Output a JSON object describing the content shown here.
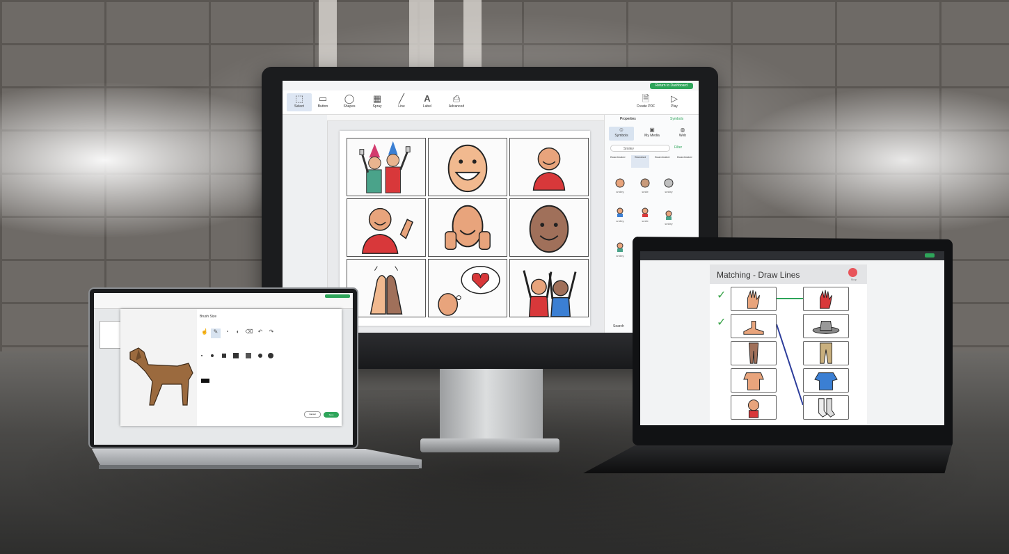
{
  "monitor": {
    "return_button": "Return to Dashboard",
    "toolbar": {
      "select": "Select",
      "button": "Button",
      "shapes": "Shapes",
      "spray": "Spray",
      "line": "Line",
      "label": "Label",
      "advanced": "Advanced",
      "create_pdf": "Create PDF",
      "play": "Play"
    },
    "properties": {
      "tabs": [
        "Properties",
        "Symbols"
      ],
      "sources": [
        "Symbols",
        "My Media",
        "Web"
      ],
      "search_value": "Smiley",
      "filter": "Filter",
      "libraries": [
        "Boardmaker",
        "Standard",
        "Boardmaker",
        "Boardmaker"
      ],
      "symbol_labels": [
        "smiley",
        "smile",
        "smiley",
        "smiley",
        "smile",
        "smiley",
        "smiley"
      ],
      "footer": "Search"
    },
    "grid_cells": [
      "party",
      "smile-face",
      "child-smile",
      "wave-hand",
      "thumbs-up",
      "brown-face",
      "high-five",
      "love-thought",
      "cheer"
    ]
  },
  "left_laptop": {
    "dialog_title": "Brush Size",
    "tool_labels": [
      "Select",
      "Brush",
      "Fill",
      "Color",
      "Erase",
      "Undo",
      "Redo"
    ],
    "cancel": "Cancel",
    "save": "Save"
  },
  "right_laptop": {
    "title": "Matching - Draw Lines",
    "stop_label": "Stop",
    "left_items": [
      "hand-icon",
      "feet-icon",
      "legs-icon",
      "torso-icon",
      "head-icon"
    ],
    "right_items": [
      "glove-icon",
      "hat-icon",
      "pants-icon",
      "shirt-icon",
      "socks-icon"
    ],
    "checked_rows": 2
  },
  "colors": {
    "accent": "#2ea55a",
    "line_green": "#2ea55a",
    "line_blue": "#2c3c9a"
  }
}
